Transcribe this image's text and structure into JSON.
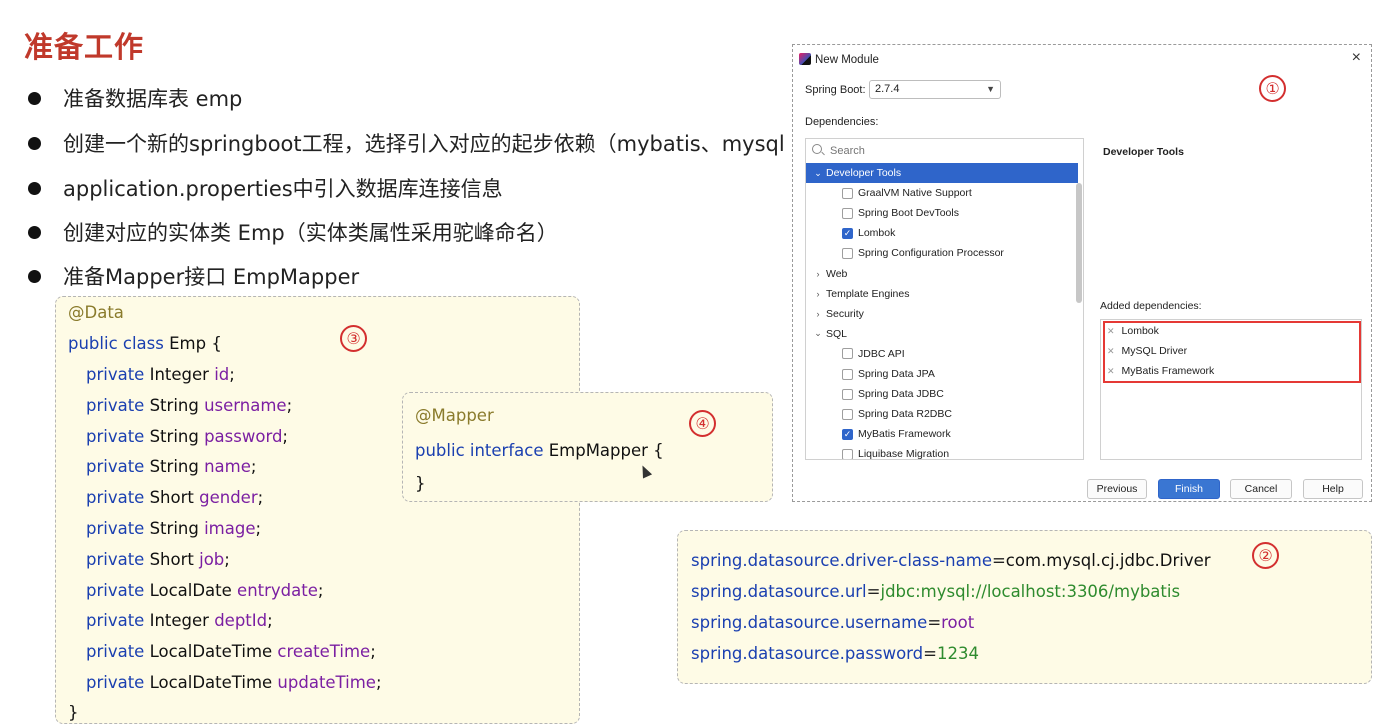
{
  "title": "准备工作",
  "bullets": [
    "准备数据库表 emp",
    "创建一个新的springboot工程，选择引入对应的起步依赖（mybatis、mysql",
    "application.properties中引入数据库连接信息",
    "创建对应的实体类 Emp（实体类属性采用驼峰命名）",
    "准备Mapper接口 EmpMapper"
  ],
  "entity_code": {
    "annotation": "@Data",
    "decl_keyword": "public class",
    "decl_rest": " Emp {",
    "fields": [
      {
        "kw": "private",
        "type": " Integer ",
        "name": "id",
        "end": ";"
      },
      {
        "kw": "private",
        "type": " String ",
        "name": "username",
        "end": ";"
      },
      {
        "kw": "private",
        "type": " String ",
        "name": "password",
        "end": ";"
      },
      {
        "kw": "private",
        "type": " String ",
        "name": "name",
        "end": ";"
      },
      {
        "kw": "private",
        "type": " Short ",
        "name": "gender",
        "end": ";"
      },
      {
        "kw": "private",
        "type": " String ",
        "name": "image",
        "end": ";"
      },
      {
        "kw": "private",
        "type": " Short ",
        "name": "job",
        "end": ";"
      },
      {
        "kw": "private",
        "type": " LocalDate ",
        "name": "entrydate",
        "end": ";"
      },
      {
        "kw": "private",
        "type": " Integer ",
        "name": "deptId",
        "end": ";"
      },
      {
        "kw": "private",
        "type": " LocalDateTime ",
        "name": "createTime",
        "end": ";"
      },
      {
        "kw": "private",
        "type": " LocalDateTime ",
        "name": "updateTime",
        "end": ";"
      }
    ],
    "close": "}",
    "marker": "③"
  },
  "mapper_code": {
    "annotation": "@Mapper",
    "decl_keyword": "public interface",
    "decl_rest": " EmpMapper {",
    "close": "}",
    "marker": "④"
  },
  "dialog": {
    "title": "New Module",
    "close": "×",
    "marker": "①",
    "spring_boot_label": "Spring Boot:",
    "spring_boot_version": "2.7.4",
    "dependencies_label": "Dependencies:",
    "search_placeholder": "Search",
    "tree": [
      {
        "kind": "group",
        "label": "Developer Tools",
        "expanded": true,
        "selected": true
      },
      {
        "kind": "item",
        "label": "GraalVM Native Support",
        "checked": false
      },
      {
        "kind": "item",
        "label": "Spring Boot DevTools",
        "checked": false
      },
      {
        "kind": "item",
        "label": "Lombok",
        "checked": true
      },
      {
        "kind": "item",
        "label": "Spring Configuration Processor",
        "checked": false
      },
      {
        "kind": "group",
        "label": "Web",
        "expanded": false
      },
      {
        "kind": "group",
        "label": "Template Engines",
        "expanded": false
      },
      {
        "kind": "group",
        "label": "Security",
        "expanded": false
      },
      {
        "kind": "group",
        "label": "SQL",
        "expanded": true
      },
      {
        "kind": "item",
        "label": "JDBC API",
        "checked": false
      },
      {
        "kind": "item",
        "label": "Spring Data JPA",
        "checked": false
      },
      {
        "kind": "item",
        "label": "Spring Data JDBC",
        "checked": false
      },
      {
        "kind": "item",
        "label": "Spring Data R2DBC",
        "checked": false
      },
      {
        "kind": "item",
        "label": "MyBatis Framework",
        "checked": true
      },
      {
        "kind": "item",
        "label": "Liquibase Migration",
        "checked": false
      }
    ],
    "detail_title": "Developer Tools",
    "added_label": "Added dependencies:",
    "added": [
      "Lombok",
      "MySQL Driver",
      "MyBatis Framework"
    ],
    "buttons": {
      "previous": "Previous",
      "finish": "Finish",
      "cancel": "Cancel",
      "help": "Help"
    }
  },
  "properties": {
    "marker": "②",
    "lines": [
      {
        "key": "spring.datasource.driver-class-name",
        "eq": "=",
        "value": "com.mysql.cj.jdbc.Driver",
        "color": "#111111"
      },
      {
        "key": "spring.datasource.url",
        "eq": "=",
        "value": "jdbc:mysql://localhost:3306/mybatis",
        "color": "#2e8b2e"
      },
      {
        "key": "spring.datasource.username",
        "eq": "=",
        "value": "root",
        "color": "#7b1fa2"
      },
      {
        "key": "spring.datasource.password",
        "eq": "=",
        "value": "1234",
        "color": "#2e8b2e"
      }
    ]
  },
  "colors": {
    "title": "#c0392b",
    "keyword": "#1a3fb0",
    "field": "#7b1fa2",
    "marker": "#d32f2f",
    "highlight": "#e53935",
    "selection": "#2f65ca"
  }
}
